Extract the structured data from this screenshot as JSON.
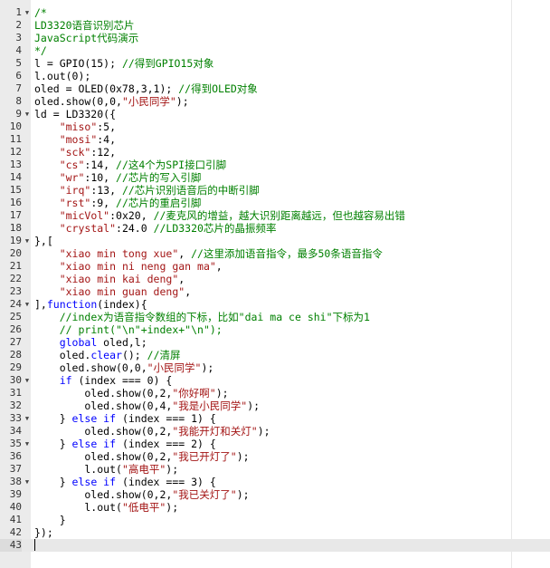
{
  "editor": {
    "colors": {
      "comment": "#008000",
      "string": "#a31515",
      "keyword": "#0000ff",
      "text": "#000000",
      "gutter": "#ebebeb",
      "active_line": "#e8e8e8"
    },
    "fold_icon": "triangle-down-icon",
    "active_line": 43,
    "lines": [
      {
        "n": "1",
        "fold": true,
        "tokens": [
          [
            "comment",
            "/*"
          ]
        ]
      },
      {
        "n": "2",
        "fold": false,
        "tokens": [
          [
            "comment",
            "LD3320语音识别芯片"
          ]
        ]
      },
      {
        "n": "3",
        "fold": false,
        "tokens": [
          [
            "comment",
            "JavaScript代码演示"
          ]
        ]
      },
      {
        "n": "4",
        "fold": false,
        "tokens": [
          [
            "comment",
            "*/"
          ]
        ]
      },
      {
        "n": "5",
        "fold": false,
        "tokens": [
          [
            "text",
            "l = GPIO(15); "
          ],
          [
            "comment",
            "//得到GPIO15对象"
          ]
        ]
      },
      {
        "n": "6",
        "fold": false,
        "tokens": [
          [
            "text",
            "l.out(0);"
          ]
        ]
      },
      {
        "n": "7",
        "fold": false,
        "tokens": [
          [
            "text",
            "oled = OLED(0x78,3,1); "
          ],
          [
            "comment",
            "//得到OLED对象"
          ]
        ]
      },
      {
        "n": "8",
        "fold": false,
        "tokens": [
          [
            "text",
            "oled.show(0,0,"
          ],
          [
            "string",
            "\"小民同学\""
          ],
          [
            "text",
            ");"
          ]
        ]
      },
      {
        "n": "9",
        "fold": true,
        "tokens": [
          [
            "text",
            "ld = LD3320({"
          ]
        ]
      },
      {
        "n": "10",
        "fold": false,
        "tokens": [
          [
            "text",
            "    "
          ],
          [
            "string",
            "\"miso\""
          ],
          [
            "text",
            ":5,"
          ]
        ]
      },
      {
        "n": "11",
        "fold": false,
        "tokens": [
          [
            "text",
            "    "
          ],
          [
            "string",
            "\"mosi\""
          ],
          [
            "text",
            ":4,"
          ]
        ]
      },
      {
        "n": "12",
        "fold": false,
        "tokens": [
          [
            "text",
            "    "
          ],
          [
            "string",
            "\"sck\""
          ],
          [
            "text",
            ":12,"
          ]
        ]
      },
      {
        "n": "13",
        "fold": false,
        "tokens": [
          [
            "text",
            "    "
          ],
          [
            "string",
            "\"cs\""
          ],
          [
            "text",
            ":14, "
          ],
          [
            "comment",
            "//这4个为SPI接口引脚"
          ]
        ]
      },
      {
        "n": "14",
        "fold": false,
        "tokens": [
          [
            "text",
            "    "
          ],
          [
            "string",
            "\"wr\""
          ],
          [
            "text",
            ":10, "
          ],
          [
            "comment",
            "//芯片的写入引脚"
          ]
        ]
      },
      {
        "n": "15",
        "fold": false,
        "tokens": [
          [
            "text",
            "    "
          ],
          [
            "string",
            "\"irq\""
          ],
          [
            "text",
            ":13, "
          ],
          [
            "comment",
            "//芯片识别语音后的中断引脚"
          ]
        ]
      },
      {
        "n": "16",
        "fold": false,
        "tokens": [
          [
            "text",
            "    "
          ],
          [
            "string",
            "\"rst\""
          ],
          [
            "text",
            ":9, "
          ],
          [
            "comment",
            "//芯片的重启引脚"
          ]
        ]
      },
      {
        "n": "17",
        "fold": false,
        "tokens": [
          [
            "text",
            "    "
          ],
          [
            "string",
            "\"micVol\""
          ],
          [
            "text",
            ":0x20, "
          ],
          [
            "comment",
            "//麦克风的增益，越大识别距离越远，但也越容易出错"
          ]
        ]
      },
      {
        "n": "18",
        "fold": false,
        "tokens": [
          [
            "text",
            "    "
          ],
          [
            "string",
            "\"crystal\""
          ],
          [
            "text",
            ":24.0 "
          ],
          [
            "comment",
            "//LD3320芯片的晶振频率"
          ]
        ]
      },
      {
        "n": "19",
        "fold": true,
        "tokens": [
          [
            "text",
            "},["
          ]
        ]
      },
      {
        "n": "20",
        "fold": false,
        "tokens": [
          [
            "text",
            "    "
          ],
          [
            "string",
            "\"xiao min tong xue\""
          ],
          [
            "text",
            ", "
          ],
          [
            "comment",
            "//这里添加语音指令，最多50条语音指令"
          ]
        ]
      },
      {
        "n": "21",
        "fold": false,
        "tokens": [
          [
            "text",
            "    "
          ],
          [
            "string",
            "\"xiao min ni neng gan ma\""
          ],
          [
            "text",
            ","
          ]
        ]
      },
      {
        "n": "22",
        "fold": false,
        "tokens": [
          [
            "text",
            "    "
          ],
          [
            "string",
            "\"xiao min kai deng\""
          ],
          [
            "text",
            ","
          ]
        ]
      },
      {
        "n": "23",
        "fold": false,
        "tokens": [
          [
            "text",
            "    "
          ],
          [
            "string",
            "\"xiao min guan deng\""
          ],
          [
            "text",
            ","
          ]
        ]
      },
      {
        "n": "24",
        "fold": true,
        "tokens": [
          [
            "text",
            "],"
          ],
          [
            "keyword",
            "function"
          ],
          [
            "text",
            "(index){"
          ]
        ]
      },
      {
        "n": "25",
        "fold": false,
        "tokens": [
          [
            "text",
            "    "
          ],
          [
            "comment",
            "//index为语音指令数组的下标，比如\"dai ma ce shi\"下标为1"
          ]
        ]
      },
      {
        "n": "26",
        "fold": false,
        "tokens": [
          [
            "text",
            "    "
          ],
          [
            "comment",
            "// print(\"\\n\"+index+\"\\n\");"
          ]
        ]
      },
      {
        "n": "27",
        "fold": false,
        "tokens": [
          [
            "text",
            "    "
          ],
          [
            "keyword",
            "global"
          ],
          [
            "text",
            " oled,l;"
          ]
        ]
      },
      {
        "n": "28",
        "fold": false,
        "tokens": [
          [
            "text",
            "    oled."
          ],
          [
            "keyword",
            "clear"
          ],
          [
            "text",
            "(); "
          ],
          [
            "comment",
            "//清屏"
          ]
        ]
      },
      {
        "n": "29",
        "fold": false,
        "tokens": [
          [
            "text",
            "    oled.show(0,0,"
          ],
          [
            "string",
            "\"小民同学\""
          ],
          [
            "text",
            ");"
          ]
        ]
      },
      {
        "n": "30",
        "fold": true,
        "tokens": [
          [
            "text",
            "    "
          ],
          [
            "keyword",
            "if"
          ],
          [
            "text",
            " (index === 0) {"
          ]
        ]
      },
      {
        "n": "31",
        "fold": false,
        "tokens": [
          [
            "text",
            "        oled.show(0,2,"
          ],
          [
            "string",
            "\"你好啊\""
          ],
          [
            "text",
            ");"
          ]
        ]
      },
      {
        "n": "32",
        "fold": false,
        "tokens": [
          [
            "text",
            "        oled.show(0,4,"
          ],
          [
            "string",
            "\"我是小民同学\""
          ],
          [
            "text",
            ");"
          ]
        ]
      },
      {
        "n": "33",
        "fold": true,
        "tokens": [
          [
            "text",
            "    } "
          ],
          [
            "keyword",
            "else if"
          ],
          [
            "text",
            " (index === 1) {"
          ]
        ]
      },
      {
        "n": "34",
        "fold": false,
        "tokens": [
          [
            "text",
            "        oled.show(0,2,"
          ],
          [
            "string",
            "\"我能开灯和关灯\""
          ],
          [
            "text",
            ");"
          ]
        ]
      },
      {
        "n": "35",
        "fold": true,
        "tokens": [
          [
            "text",
            "    } "
          ],
          [
            "keyword",
            "else if"
          ],
          [
            "text",
            " (index === 2) {"
          ]
        ]
      },
      {
        "n": "36",
        "fold": false,
        "tokens": [
          [
            "text",
            "        oled.show(0,2,"
          ],
          [
            "string",
            "\"我已开灯了\""
          ],
          [
            "text",
            ");"
          ]
        ]
      },
      {
        "n": "37",
        "fold": false,
        "tokens": [
          [
            "text",
            "        l.out("
          ],
          [
            "string",
            "\"高电平\""
          ],
          [
            "text",
            ");"
          ]
        ]
      },
      {
        "n": "38",
        "fold": true,
        "tokens": [
          [
            "text",
            "    } "
          ],
          [
            "keyword",
            "else if"
          ],
          [
            "text",
            " (index === 3) {"
          ]
        ]
      },
      {
        "n": "39",
        "fold": false,
        "tokens": [
          [
            "text",
            "        oled.show(0,2,"
          ],
          [
            "string",
            "\"我已关灯了\""
          ],
          [
            "text",
            ");"
          ]
        ]
      },
      {
        "n": "40",
        "fold": false,
        "tokens": [
          [
            "text",
            "        l.out("
          ],
          [
            "string",
            "\"低电平\""
          ],
          [
            "text",
            ");"
          ]
        ]
      },
      {
        "n": "41",
        "fold": false,
        "tokens": [
          [
            "text",
            "    }"
          ]
        ]
      },
      {
        "n": "42",
        "fold": false,
        "tokens": [
          [
            "text",
            "});"
          ]
        ]
      },
      {
        "n": "43",
        "fold": false,
        "tokens": []
      }
    ]
  }
}
